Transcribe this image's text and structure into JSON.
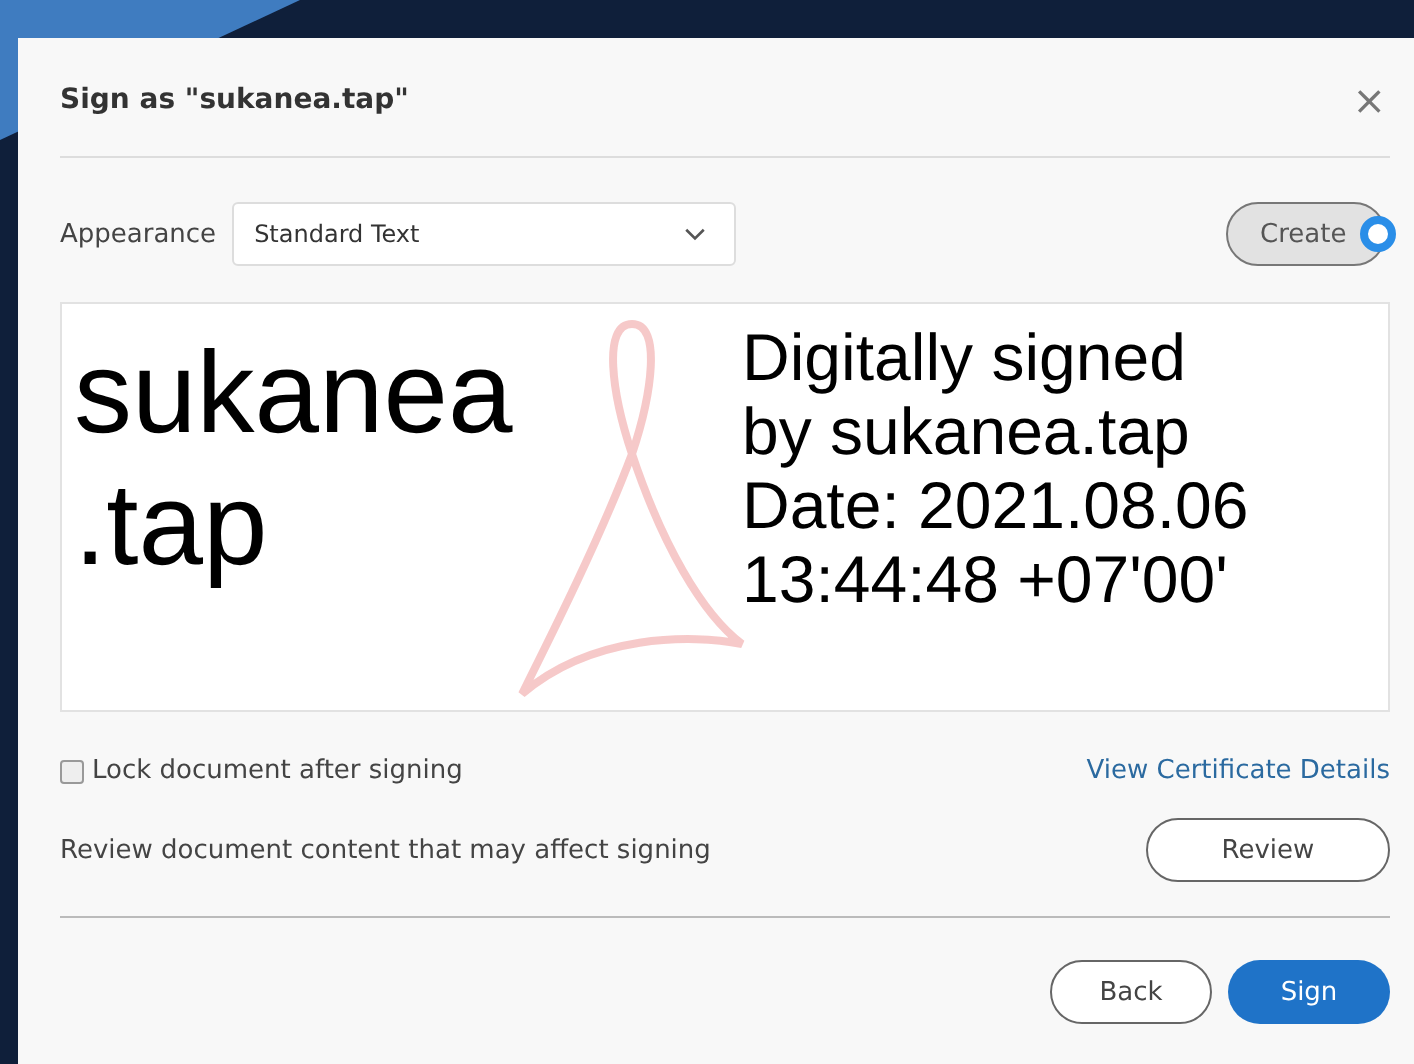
{
  "dialog": {
    "title": "Sign as \"sukanea.tap\"",
    "close": "×"
  },
  "appearance": {
    "label": "Appearance",
    "value": "Standard Text",
    "create_button": "Create"
  },
  "preview": {
    "name_lines": [
      "sukanea",
      ".tap"
    ],
    "detail_lines": [
      "Digitally signed",
      "by sukanea.tap",
      "Date: 2021.08.06",
      "13:44:48 +07'00'"
    ]
  },
  "lock": {
    "label": "Lock document after signing",
    "checked": false
  },
  "certificate_link": "View Certificate Details",
  "review": {
    "text": "Review document content that may affect signing",
    "button": "Review"
  },
  "buttons": [
    {
      "label": "Back",
      "kind": "secondary"
    },
    {
      "label": "Sign",
      "kind": "primary"
    }
  ]
}
